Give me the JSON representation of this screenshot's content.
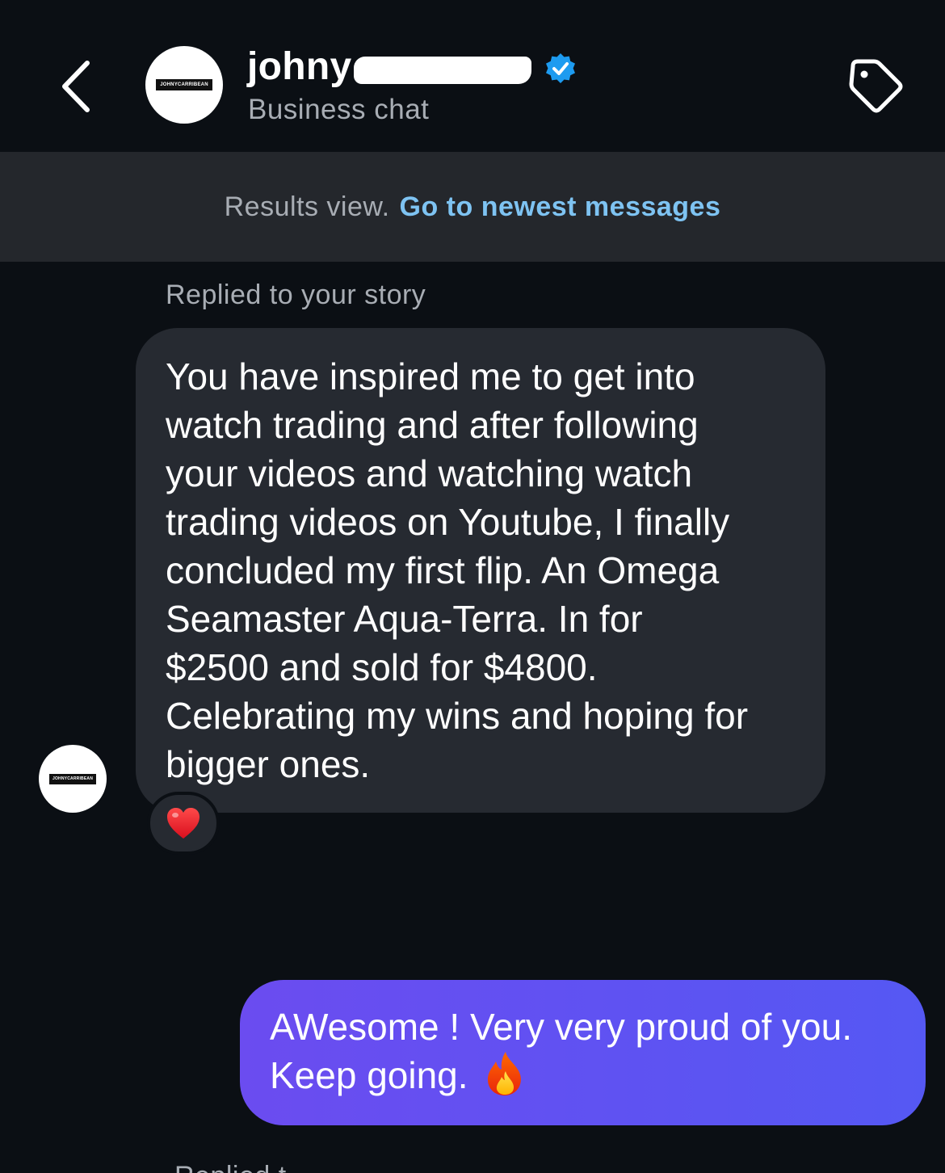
{
  "header": {
    "name_visible": "johny",
    "subtitle": "Business chat",
    "avatar_logo_text": "JOHNYCARRIBEAN",
    "icons": {
      "back": "chevron-left-icon",
      "verified": "verified-badge-icon",
      "tag": "tag-icon"
    },
    "colors": {
      "verified_badge": "#1d9bf0"
    }
  },
  "banner": {
    "text": "Results view.",
    "link": "Go to newest messages"
  },
  "messages": [
    {
      "label": "Replied to your story",
      "direction": "incoming",
      "text": "You have inspired me to get into\nwatch trading and after following\nyour videos and watching watch\ntrading videos on Youtube, I finally\nconcluded my first flip.  An Omega\nSeamaster Aqua-Terra.  In for\n$2500 and sold for $4800.\nCelebrating my wins and hoping for\nbigger ones.",
      "avatar_logo_text": "JOHNYCARRIBEAN",
      "reaction": "heart-emoji"
    },
    {
      "direction": "outgoing",
      "line1": "AWesome ! Very very proud of you.",
      "line2": "Keep going.",
      "emoji": "fire-emoji",
      "colors": {
        "bubble_start": "#6b4cf0",
        "bubble_end": "#5558f3"
      }
    }
  ],
  "next_label_partial": "Replied t"
}
